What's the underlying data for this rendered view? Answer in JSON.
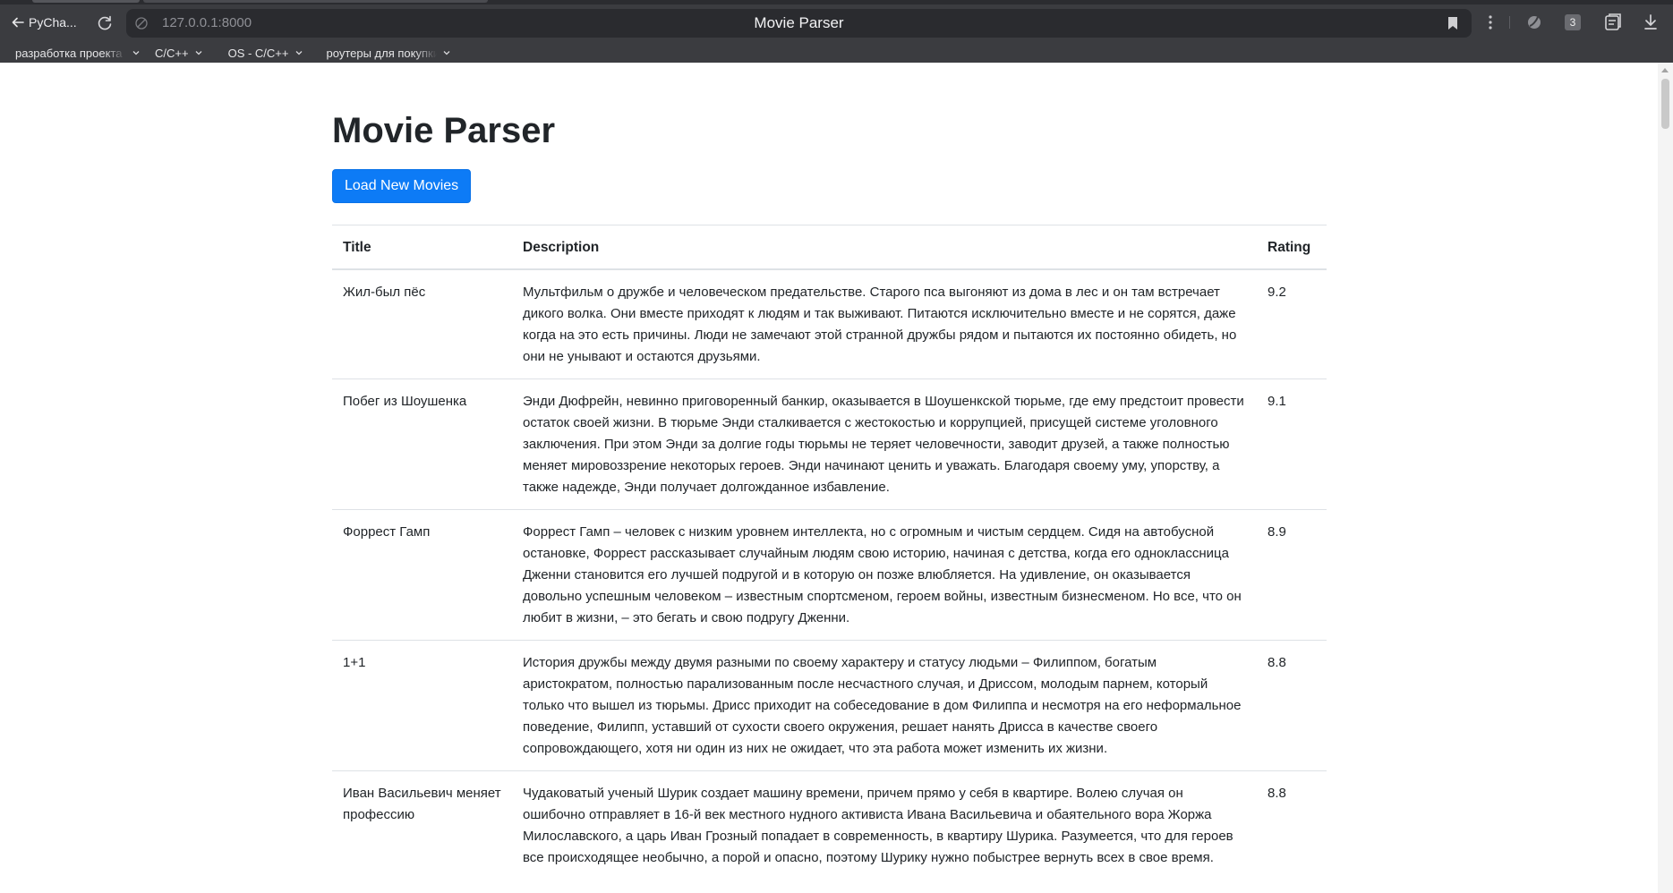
{
  "browser": {
    "back_label": "PyCha...",
    "url": "127.0.0.1:8000",
    "tab_title": "Movie Parser",
    "tab_count": "3",
    "bookmarks": [
      {
        "label": "разработка проекта"
      },
      {
        "label": "C/C++"
      },
      {
        "label": "OS - C/C++"
      },
      {
        "label": "роутеры для покупки"
      }
    ],
    "icons": {
      "back": "arrow-left-icon",
      "reload": "reload-icon",
      "site": "site-info-icon",
      "bookmark": "bookmark-icon",
      "menu": "kebab-menu-icon",
      "extension": "extension-icon",
      "collections": "collections-icon",
      "download": "download-icon"
    }
  },
  "page": {
    "heading": "Movie Parser",
    "load_button": "Load New Movies",
    "accent_color": "#0d7bf6",
    "table": {
      "columns": [
        "Title",
        "Description",
        "Rating"
      ],
      "rows": [
        {
          "title": "Жил-был пёс",
          "description": "Мультфильм о дружбе и человеческом предательстве. Старого пса выгоняют из дома в лес и он там встречает дикого волка. Они вместе приходят к людям и так выживают. Питаются исключительно вместе и не сорятся, даже когда на это есть причины. Люди не замечают этой странной дружбы рядом и пытаются их постоянно обидеть, но они не унывают и остаются друзьями.",
          "rating": "9.2"
        },
        {
          "title": "Побег из Шоушенка",
          "description": "Энди Дюфрейн, невинно приговоренный банкир, оказывается в Шоушенкской тюрьме, где ему предстоит провести остаток своей жизни. В тюрьме Энди сталкивается с жестокостью и коррупцией, присущей системе уголовного заключения. При этом Энди за долгие годы тюрьмы не теряет человечности, заводит друзей, а также полностью меняет мировоззрение некоторых героев. Энди начинают ценить и уважать. Благодаря своему уму, упорству, а также надежде, Энди получает долгожданное избавление.",
          "rating": "9.1"
        },
        {
          "title": "Форрест Гамп",
          "description": "Форрест Гамп – человек с низким уровнем интеллекта, но с огромным и чистым сердцем. Сидя на автобусной остановке, Форрест рассказывает случайным людям свою историю, начиная с детства, когда его одноклассница Дженни становится его лучшей подругой и в которую он позже влюбляется. На удивление, он оказывается довольно успешным человеком – известным спортсменом, героем войны, известным бизнесменом. Но все, что он любит в жизни, – это бегать и свою подругу Дженни.",
          "rating": "8.9"
        },
        {
          "title": "1+1",
          "description": "История дружбы между двумя разными по своему характеру и статусу людьми – Филиппом, богатым аристократом, полностью парализованным после несчастного случая, и Дриссом, молодым парнем, который только что вышел из тюрьмы. Дрисс приходит на собеседование в дом Филиппа и несмотря на его неформальное поведение, Филипп, уставший от сухости своего окружения, решает нанять Дрисса в качестве своего сопровождающего, хотя ни один из них не ожидает, что эта работа может изменить их жизни.",
          "rating": "8.8"
        },
        {
          "title": "Иван Васильевич меняет профессию",
          "description": "Чудаковатый ученый Шурик создает машину времени, причем прямо у себя в квартире. Волею случая он ошибочно отправляет в 16-й век местного нудного активиста Ивана Васильевича и обаятельного вора Жоржа Милославского, а царь Иван Грозный попадает в современность, в квартиру Шурика. Разумеется, что для героев все происходящее необычно, а порой и опасно, поэтому Шурику нужно побыстрее вернуть всех в свое время.",
          "rating": "8.8"
        }
      ]
    }
  }
}
